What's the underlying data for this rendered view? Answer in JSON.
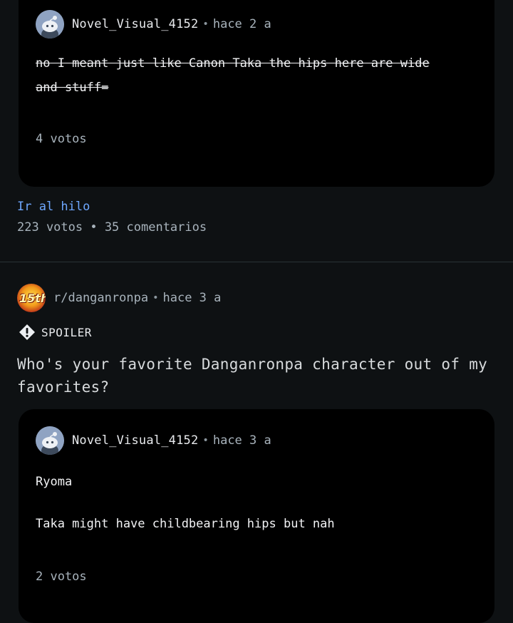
{
  "comment1": {
    "username": "Novel_Visual_4152",
    "time": "hace 2 a",
    "text": "no I meant just like Canon Taka the hips here are wide and stuff=",
    "votes": "4 votos"
  },
  "thread1": {
    "goto_label": "Ir al hilo",
    "stats": "223 votos • 35 comentarios"
  },
  "post2": {
    "subreddit": "r/danganronpa",
    "time": "hace 3 a",
    "subreddit_icon_text": "15th",
    "spoiler_label": "SPOILER",
    "title": "Who's your favorite Danganronpa character out of my favorites?"
  },
  "comment2": {
    "username": "Novel_Visual_4152",
    "time": "hace 3 a",
    "line1": "Ryoma",
    "line2": "Taka might have childbearing hips but nah",
    "votes": "2 votos"
  },
  "separator": "•",
  "colors": {
    "background": "#0e1113",
    "card": "#000000",
    "link": "#6ea7ff",
    "muted": "#a8b3bc"
  },
  "icons": {
    "avatar": "snoo-avatar-icon",
    "spoiler": "spoiler-warning-icon"
  }
}
